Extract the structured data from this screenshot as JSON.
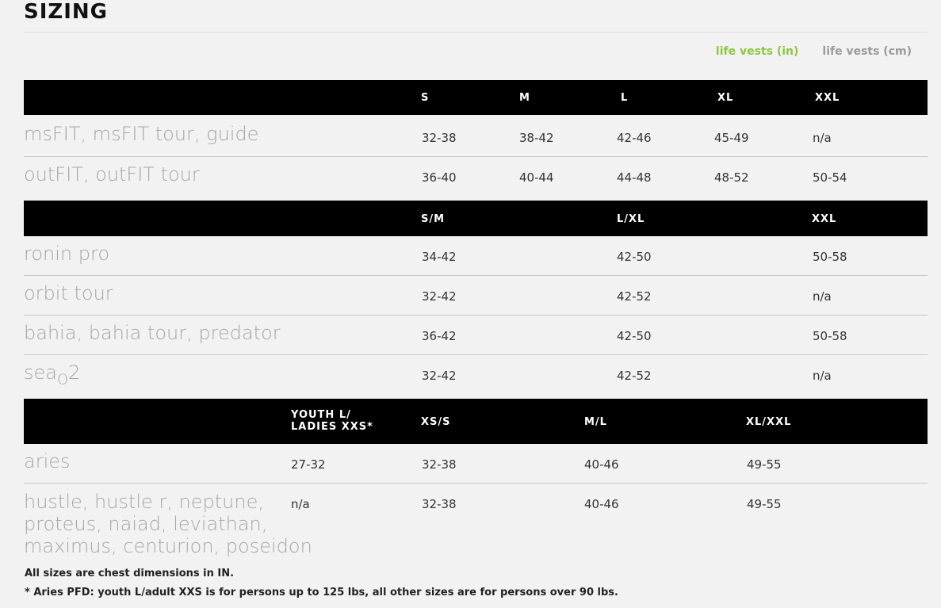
{
  "page": {
    "title": "SIZING"
  },
  "unit_tabs": [
    {
      "label": "life vests (in)",
      "active": true
    },
    {
      "label": "life vests (cm)",
      "active": false
    }
  ],
  "colors": {
    "accent_green": "#8dc63f",
    "header_bg": "#000000",
    "product_name": "#a6a6a6"
  },
  "sections": [
    {
      "headers": [
        "S",
        "M",
        "L",
        "XL",
        "XXL"
      ],
      "rows": [
        {
          "name": "msFIT, msFIT tour, guide",
          "values": [
            "32-38",
            "38-42",
            "42-46",
            "45-49",
            "n/a"
          ]
        },
        {
          "name": "outFIT, outFIT tour",
          "values": [
            "36-40",
            "40-44",
            "44-48",
            "48-52",
            "50-54"
          ]
        }
      ]
    },
    {
      "headers": [
        "S/M",
        "L/XL",
        "XXL"
      ],
      "rows": [
        {
          "name": "ronin pro",
          "values": [
            "34-42",
            "42-50",
            "50-58"
          ]
        },
        {
          "name": "orbit tour",
          "values": [
            "32-42",
            "42-52",
            "n/a"
          ]
        },
        {
          "name": "bahia, bahia tour, predator",
          "values": [
            "36-42",
            "42-50",
            "50-58"
          ]
        },
        {
          "name_parts": [
            "sea",
            "O",
            "2"
          ],
          "values": [
            "32-42",
            "42-52",
            "n/a"
          ]
        }
      ]
    },
    {
      "headers": [
        "YOUTH L/\nLADIES XXS*",
        "XS/S",
        "M/L",
        "XL/XXL"
      ],
      "rows": [
        {
          "name": "aries",
          "values": [
            "27-32",
            "32-38",
            "40-46",
            "49-55"
          ]
        },
        {
          "name": "hustle, hustle r, neptune,\nproteus, naiad, leviathan,\nmaximus, centurion, poseidon",
          "values": [
            "n/a",
            "32-38",
            "40-46",
            "49-55"
          ]
        }
      ]
    }
  ],
  "footnotes": [
    "All sizes are chest dimensions in IN.",
    "* Aries PFD: youth L/adult XXS is for persons up to 125 lbs, all other sizes are for persons over 90 lbs."
  ]
}
